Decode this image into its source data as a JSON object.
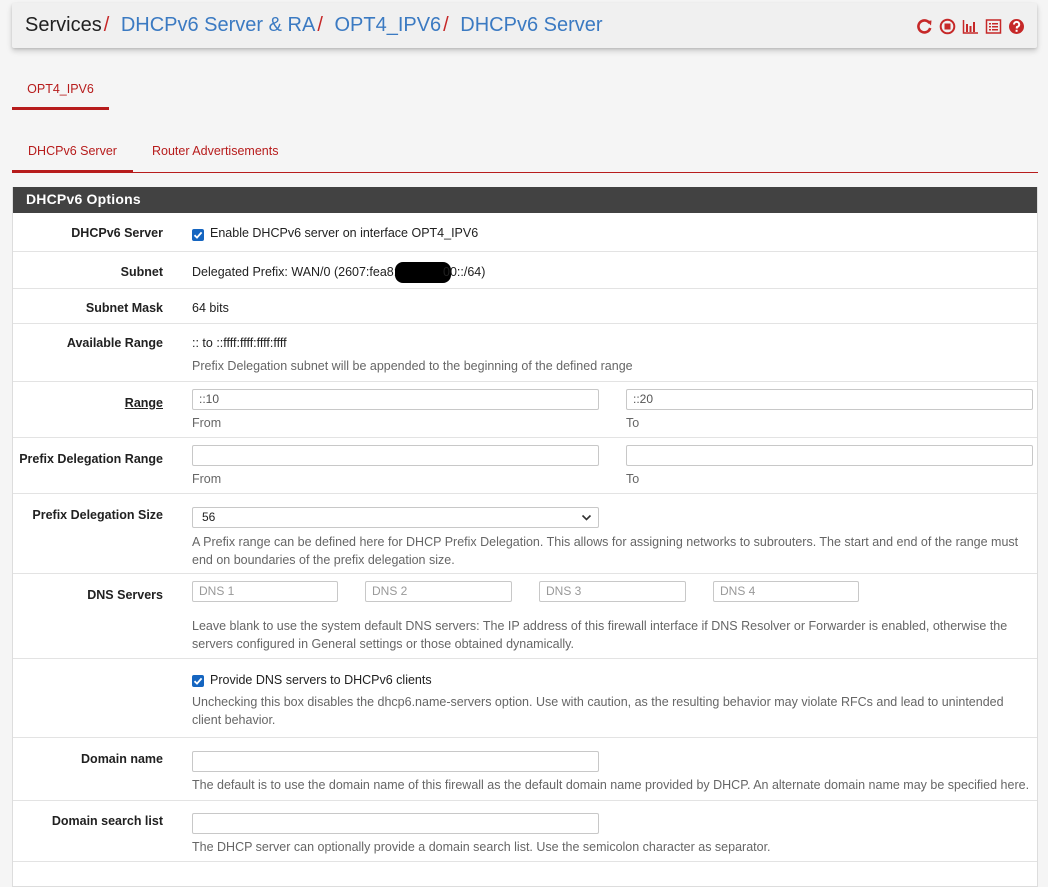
{
  "breadcrumb": {
    "root": "Services",
    "links": [
      "DHCPv6 Server & RA",
      "OPT4_IPV6",
      "DHCPv6 Server"
    ],
    "separator": "/"
  },
  "header_icons": [
    "reload-icon",
    "stop-icon",
    "chart-icon",
    "list-icon",
    "help-icon"
  ],
  "interface_tab": "OPT4_IPV6",
  "sub_tabs": [
    "DHCPv6 Server",
    "Router Advertisements"
  ],
  "panel": {
    "title": "DHCPv6 Options",
    "enable": {
      "label": "DHCPv6 Server",
      "checkbox_text": "Enable DHCPv6 server on interface OPT4_IPV6",
      "checked": true
    },
    "subnet": {
      "label": "Subnet",
      "value_prefix": "Delegated Prefix: WAN/0 (2607:fea8:",
      "value_suffix": "00::/64)"
    },
    "subnet_mask": {
      "label": "Subnet Mask",
      "value": "64 bits"
    },
    "available_range": {
      "label": "Available Range",
      "value": ":: to ::ffff:ffff:ffff:ffff",
      "help": "Prefix Delegation subnet will be appended to the beginning of the defined range"
    },
    "range": {
      "label": "Range",
      "from": "::10",
      "to": "::20",
      "from_caption": "From",
      "to_caption": "To"
    },
    "pd_range": {
      "label": "Prefix Delegation Range",
      "from": "",
      "to": "",
      "from_caption": "From",
      "to_caption": "To"
    },
    "pd_size": {
      "label": "Prefix Delegation Size",
      "selected": "56",
      "help": "A Prefix range can be defined here for DHCP Prefix Delegation. This allows for assigning networks to subrouters. The start and end of the range must end on boundaries of the prefix delegation size."
    },
    "dns": {
      "label": "DNS Servers",
      "placeholders": [
        "DNS 1",
        "DNS 2",
        "DNS 3",
        "DNS 4"
      ],
      "help": "Leave blank to use the system default DNS servers: The IP address of this firewall interface if DNS Resolver or Forwarder is enabled, otherwise the servers configured in General settings or those obtained dynamically."
    },
    "provide_dns": {
      "checkbox_text": "Provide DNS servers to DHCPv6 clients",
      "checked": true,
      "help": "Unchecking this box disables the dhcp6.name-servers option. Use with caution, as the resulting behavior may violate RFCs and lead to unintended client behavior."
    },
    "domain_name": {
      "label": "Domain name",
      "value": "",
      "help": "The default is to use the domain name of this firewall as the default domain name provided by DHCP. An alternate domain name may be specified here."
    },
    "domain_search": {
      "label": "Domain search list",
      "value": "",
      "help": "The DHCP server can optionally provide a domain search list. Use the semicolon character as separator."
    }
  },
  "colors": {
    "accent": "#b71c1c",
    "link": "#3b7ac2",
    "panel_head": "#424242",
    "checkbox": "#1565c0"
  }
}
